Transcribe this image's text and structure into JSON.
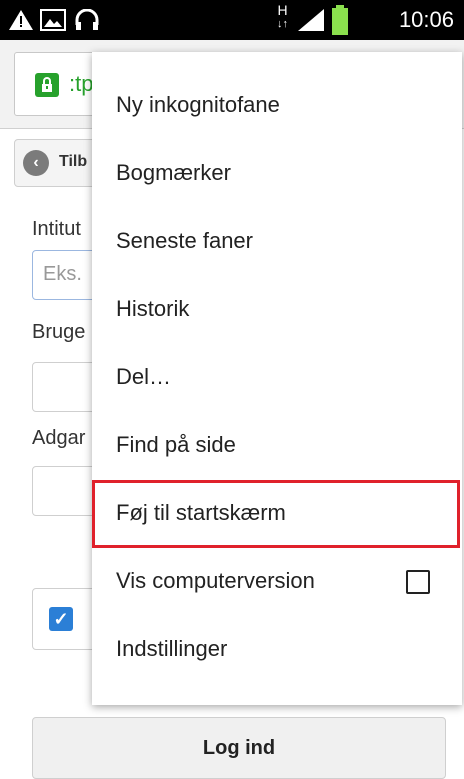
{
  "status_bar": {
    "time": "10:06",
    "network": "H"
  },
  "url_bar": {
    "url_fragment": ":tp"
  },
  "page": {
    "back_label": "Tilb",
    "institution_label": "Intitut",
    "institution_placeholder": "Eks.",
    "username_label": "Bruge",
    "password_label": "Adgar",
    "login_button": "Log ind"
  },
  "menu": {
    "items": [
      {
        "label": "Ny inkognitofane"
      },
      {
        "label": "Bogmærker"
      },
      {
        "label": "Seneste faner"
      },
      {
        "label": "Historik"
      },
      {
        "label": "Del…"
      },
      {
        "label": "Find på side"
      },
      {
        "label": "Føj til startskærm"
      },
      {
        "label": "Vis computerversion"
      },
      {
        "label": "Indstillinger"
      }
    ],
    "highlighted_item": "Føj til startskærm",
    "desktop_version_checked": false
  },
  "colors": {
    "highlight": "#e0212b",
    "secure": "#27a12c",
    "checkbox": "#2b7fd6"
  }
}
